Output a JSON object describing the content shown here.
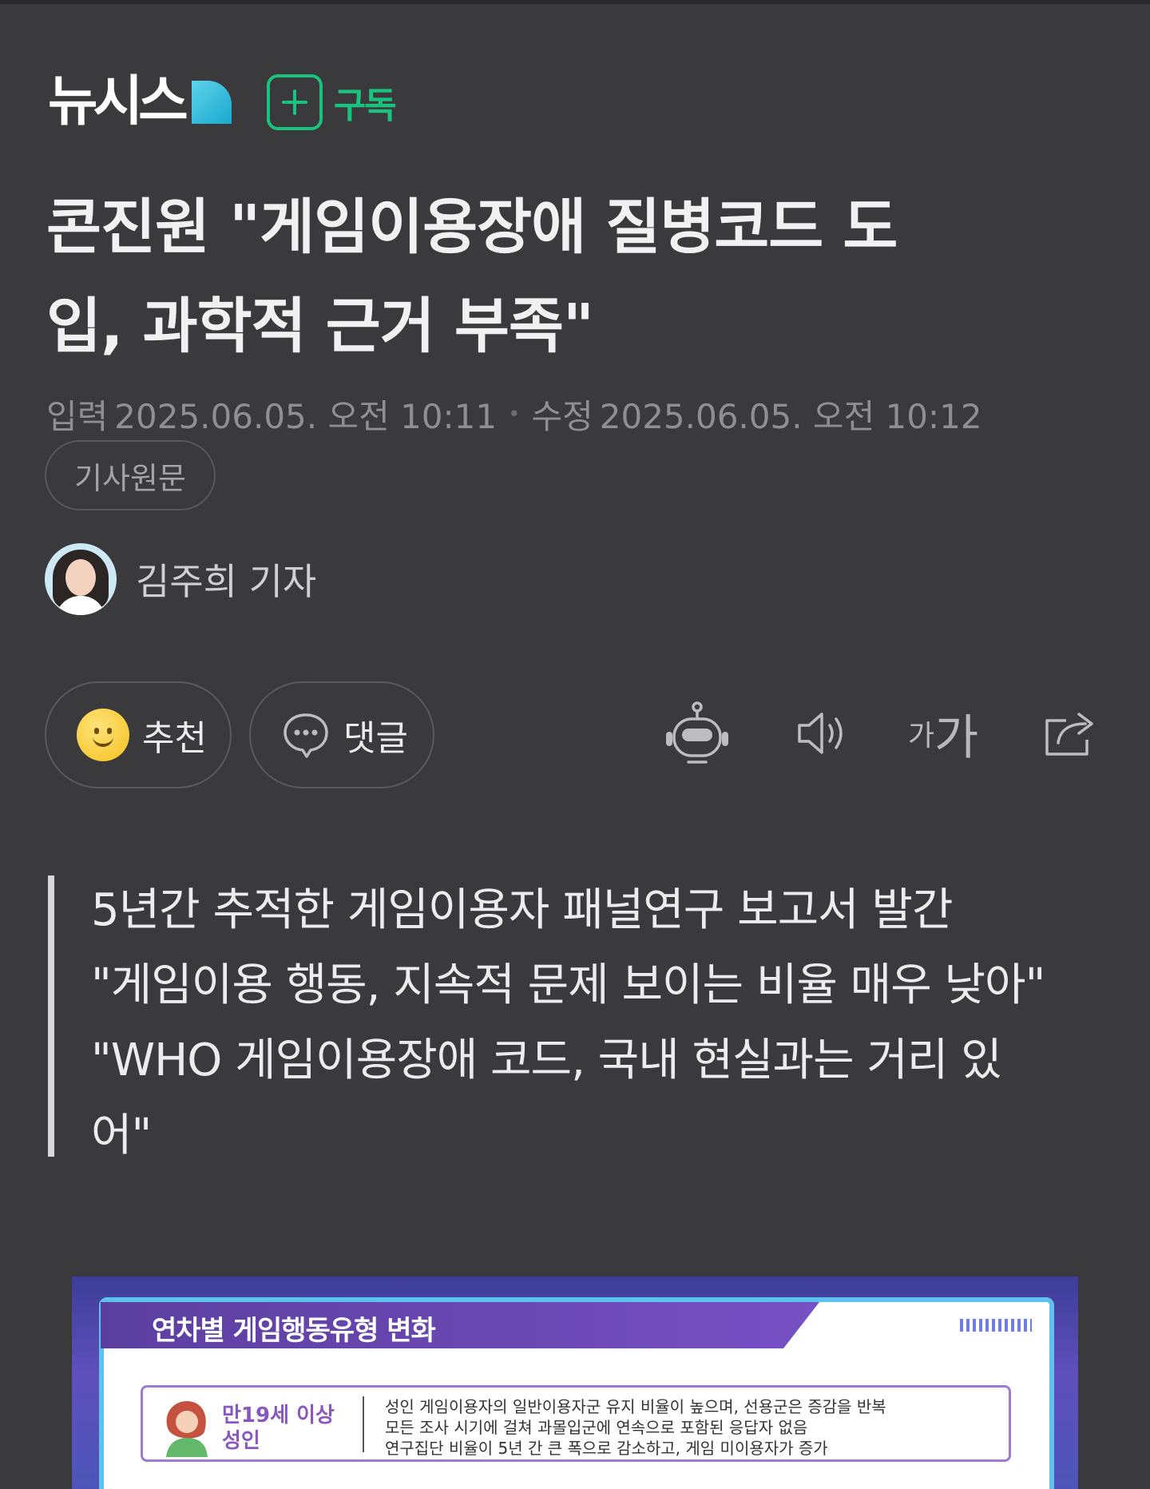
{
  "header": {
    "logo_text": "뉴시스",
    "subscribe_label": "구독",
    "accent_color": "#19c37d",
    "logo_accent_color": "#18a9cf"
  },
  "article": {
    "title_line1": "콘진원 \"게임이용장애 질병코드 도",
    "title_line2": "입, 과학적 근거 부족\"",
    "input_label": "입력",
    "input_time": "2025.06.05. 오전 10:11",
    "edit_label": "수정",
    "edit_time": "2025.06.05. 오전 10:12",
    "original_button": "기사원문",
    "reporter": "김주희 기자"
  },
  "actions": {
    "recommend_label": "추천",
    "comment_label": "댓글",
    "font_small": "가",
    "font_big": "가",
    "icons": [
      "robot-summary-icon",
      "speaker-icon",
      "font-size-icon",
      "share-icon"
    ]
  },
  "summary": {
    "lines": [
      "5년간 추적한 게임이용자 패널연구 보고서 발간",
      "\"게임이용 행동, 지속적 문제 보이는 비율 매우 낮아\"",
      "\"WHO 게임이용장애 코드, 국내 현실과는 거리 있",
      "어\""
    ]
  },
  "image": {
    "title": "연차별 게임행동유형 변화",
    "group_line1": "만19세 이상",
    "group_line2": "성인",
    "desc_lines": [
      "성인 게임이용자의 일반이용자군 유지 비율이 높으며, 선용군은 증감을 반복",
      "모든 조사 시기에 걸쳐 과몰입군에 연속으로 포함된 응답자 없음",
      "연구집단 비율이 5년 간 큰 폭으로 감소하고, 게임 미이용자가 증가"
    ]
  }
}
